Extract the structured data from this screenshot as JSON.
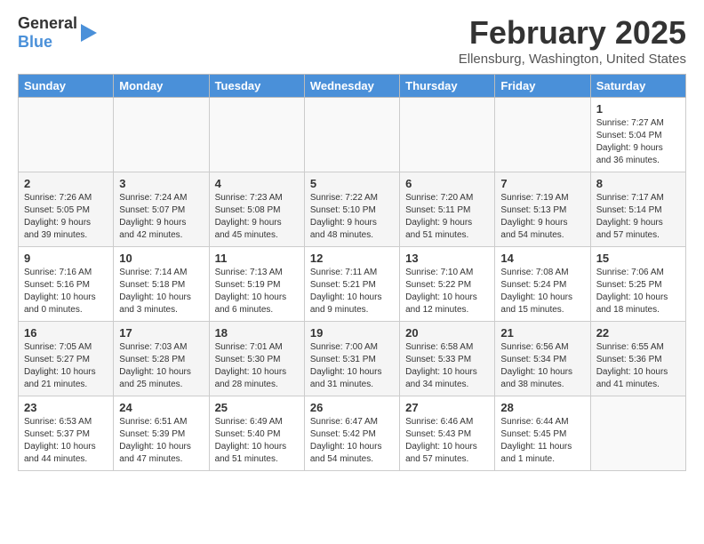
{
  "header": {
    "logo_line1": "General",
    "logo_line2": "Blue",
    "month": "February 2025",
    "location": "Ellensburg, Washington, United States"
  },
  "days_of_week": [
    "Sunday",
    "Monday",
    "Tuesday",
    "Wednesday",
    "Thursday",
    "Friday",
    "Saturday"
  ],
  "weeks": [
    [
      {
        "day": "",
        "info": ""
      },
      {
        "day": "",
        "info": ""
      },
      {
        "day": "",
        "info": ""
      },
      {
        "day": "",
        "info": ""
      },
      {
        "day": "",
        "info": ""
      },
      {
        "day": "",
        "info": ""
      },
      {
        "day": "1",
        "info": "Sunrise: 7:27 AM\nSunset: 5:04 PM\nDaylight: 9 hours and 36 minutes."
      }
    ],
    [
      {
        "day": "2",
        "info": "Sunrise: 7:26 AM\nSunset: 5:05 PM\nDaylight: 9 hours and 39 minutes."
      },
      {
        "day": "3",
        "info": "Sunrise: 7:24 AM\nSunset: 5:07 PM\nDaylight: 9 hours and 42 minutes."
      },
      {
        "day": "4",
        "info": "Sunrise: 7:23 AM\nSunset: 5:08 PM\nDaylight: 9 hours and 45 minutes."
      },
      {
        "day": "5",
        "info": "Sunrise: 7:22 AM\nSunset: 5:10 PM\nDaylight: 9 hours and 48 minutes."
      },
      {
        "day": "6",
        "info": "Sunrise: 7:20 AM\nSunset: 5:11 PM\nDaylight: 9 hours and 51 minutes."
      },
      {
        "day": "7",
        "info": "Sunrise: 7:19 AM\nSunset: 5:13 PM\nDaylight: 9 hours and 54 minutes."
      },
      {
        "day": "8",
        "info": "Sunrise: 7:17 AM\nSunset: 5:14 PM\nDaylight: 9 hours and 57 minutes."
      }
    ],
    [
      {
        "day": "9",
        "info": "Sunrise: 7:16 AM\nSunset: 5:16 PM\nDaylight: 10 hours and 0 minutes."
      },
      {
        "day": "10",
        "info": "Sunrise: 7:14 AM\nSunset: 5:18 PM\nDaylight: 10 hours and 3 minutes."
      },
      {
        "day": "11",
        "info": "Sunrise: 7:13 AM\nSunset: 5:19 PM\nDaylight: 10 hours and 6 minutes."
      },
      {
        "day": "12",
        "info": "Sunrise: 7:11 AM\nSunset: 5:21 PM\nDaylight: 10 hours and 9 minutes."
      },
      {
        "day": "13",
        "info": "Sunrise: 7:10 AM\nSunset: 5:22 PM\nDaylight: 10 hours and 12 minutes."
      },
      {
        "day": "14",
        "info": "Sunrise: 7:08 AM\nSunset: 5:24 PM\nDaylight: 10 hours and 15 minutes."
      },
      {
        "day": "15",
        "info": "Sunrise: 7:06 AM\nSunset: 5:25 PM\nDaylight: 10 hours and 18 minutes."
      }
    ],
    [
      {
        "day": "16",
        "info": "Sunrise: 7:05 AM\nSunset: 5:27 PM\nDaylight: 10 hours and 21 minutes."
      },
      {
        "day": "17",
        "info": "Sunrise: 7:03 AM\nSunset: 5:28 PM\nDaylight: 10 hours and 25 minutes."
      },
      {
        "day": "18",
        "info": "Sunrise: 7:01 AM\nSunset: 5:30 PM\nDaylight: 10 hours and 28 minutes."
      },
      {
        "day": "19",
        "info": "Sunrise: 7:00 AM\nSunset: 5:31 PM\nDaylight: 10 hours and 31 minutes."
      },
      {
        "day": "20",
        "info": "Sunrise: 6:58 AM\nSunset: 5:33 PM\nDaylight: 10 hours and 34 minutes."
      },
      {
        "day": "21",
        "info": "Sunrise: 6:56 AM\nSunset: 5:34 PM\nDaylight: 10 hours and 38 minutes."
      },
      {
        "day": "22",
        "info": "Sunrise: 6:55 AM\nSunset: 5:36 PM\nDaylight: 10 hours and 41 minutes."
      }
    ],
    [
      {
        "day": "23",
        "info": "Sunrise: 6:53 AM\nSunset: 5:37 PM\nDaylight: 10 hours and 44 minutes."
      },
      {
        "day": "24",
        "info": "Sunrise: 6:51 AM\nSunset: 5:39 PM\nDaylight: 10 hours and 47 minutes."
      },
      {
        "day": "25",
        "info": "Sunrise: 6:49 AM\nSunset: 5:40 PM\nDaylight: 10 hours and 51 minutes."
      },
      {
        "day": "26",
        "info": "Sunrise: 6:47 AM\nSunset: 5:42 PM\nDaylight: 10 hours and 54 minutes."
      },
      {
        "day": "27",
        "info": "Sunrise: 6:46 AM\nSunset: 5:43 PM\nDaylight: 10 hours and 57 minutes."
      },
      {
        "day": "28",
        "info": "Sunrise: 6:44 AM\nSunset: 5:45 PM\nDaylight: 11 hours and 1 minute."
      },
      {
        "day": "",
        "info": ""
      }
    ]
  ]
}
